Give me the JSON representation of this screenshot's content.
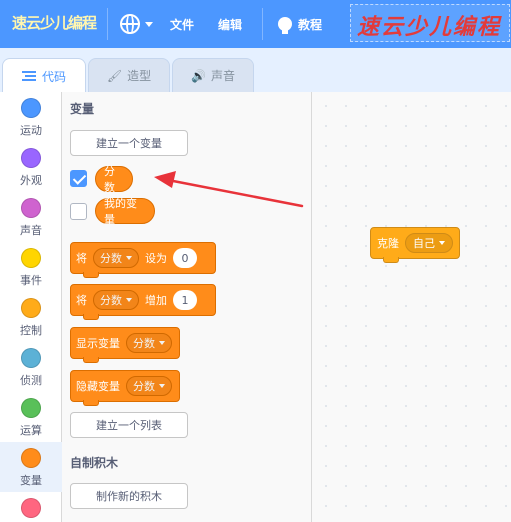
{
  "menubar": {
    "logo": "速云少儿编程",
    "file_label": "文件",
    "edit_label": "编辑",
    "tutorials_label": "教程",
    "watermark_text": "速云少儿编程"
  },
  "tabs": [
    {
      "label": "代码",
      "icon": "code-icon",
      "active": true
    },
    {
      "label": "造型",
      "icon": "brush-icon",
      "active": false
    },
    {
      "label": "声音",
      "icon": "speaker-icon",
      "active": false
    }
  ],
  "categories": [
    {
      "label": "运动",
      "color": "#4c97ff"
    },
    {
      "label": "外观",
      "color": "#9966ff"
    },
    {
      "label": "声音",
      "color": "#cf63cf"
    },
    {
      "label": "事件",
      "color": "#ffd500"
    },
    {
      "label": "控制",
      "color": "#ffab19"
    },
    {
      "label": "侦测",
      "color": "#5cb1d6"
    },
    {
      "label": "运算",
      "color": "#59c059"
    },
    {
      "label": "变量",
      "color": "#ff8c1a",
      "selected": true
    },
    {
      "label": "",
      "color": "#ff6680"
    }
  ],
  "palette": {
    "variables_title": "变量",
    "make_variable_button": "建立一个变量",
    "variables": [
      {
        "name": "分数",
        "checked": true
      },
      {
        "name": "我的变量",
        "checked": false
      }
    ],
    "set_block": {
      "verb": "将",
      "var": "分数",
      "mid": "设为",
      "value": "0"
    },
    "change_block": {
      "verb": "将",
      "var": "分数",
      "mid": "增加",
      "value": "1"
    },
    "show_block": {
      "label": "显示变量",
      "var": "分数"
    },
    "hide_block": {
      "label": "隐藏变量",
      "var": "分数"
    },
    "make_list_button": "建立一个列表",
    "my_blocks_title": "自制积木",
    "make_block_button": "制作新的积木"
  },
  "script_area": {
    "clone_block": {
      "label": "克隆",
      "target": "自己"
    }
  },
  "colors": {
    "accent": "#4c97ff",
    "variables": "#ff8c1a",
    "control": "#ffab19",
    "arrow": "#e8333a"
  }
}
